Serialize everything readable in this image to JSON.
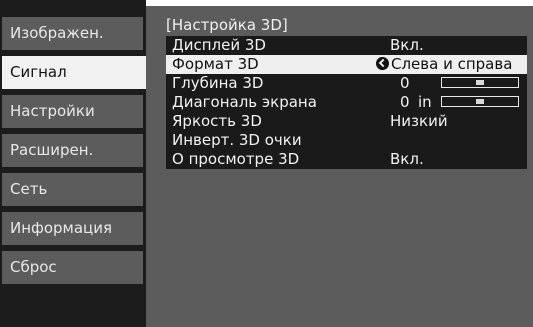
{
  "sidebar": {
    "items": [
      {
        "label": "Изображен."
      },
      {
        "label": "Сигнал",
        "active": true
      },
      {
        "label": "Настройки"
      },
      {
        "label": "Расширен."
      },
      {
        "label": "Сеть"
      },
      {
        "label": "Информация"
      },
      {
        "label": "Сброс"
      }
    ]
  },
  "panel": {
    "title": "[Настройка 3D]",
    "rows": [
      {
        "label": "Дисплей 3D",
        "value": "Вкл."
      },
      {
        "label": "Формат 3D",
        "value": "Слева и справа",
        "icon": "undo-icon"
      },
      {
        "label": "Глубина 3D",
        "value": "0",
        "slider_level": 0.5
      },
      {
        "label": "Диагональ экрана",
        "value": "0",
        "unit": "in",
        "slider_level": 0.5
      },
      {
        "label": "Яркость 3D",
        "value": "Низкий"
      },
      {
        "label": "Инверт. 3D очки",
        "value": ""
      },
      {
        "label": "О просмотре 3D",
        "value": "Вкл."
      }
    ]
  }
}
